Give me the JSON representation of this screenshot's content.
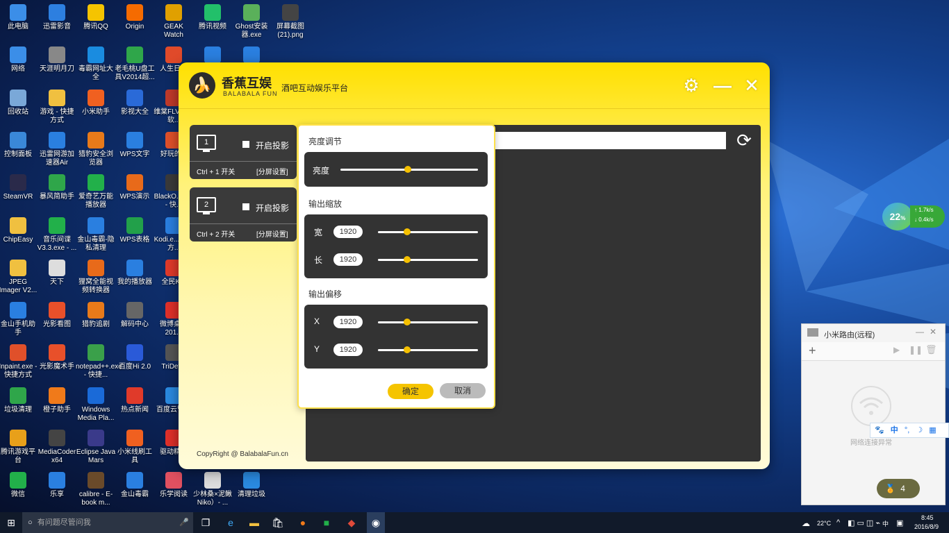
{
  "desktop": {
    "icons": [
      {
        "label": "此电脑",
        "color": "#3b8ee8"
      },
      {
        "label": "迅雷影音",
        "color": "#2d7fe0"
      },
      {
        "label": "腾讯QQ",
        "color": "#f5c400"
      },
      {
        "label": "Origin",
        "color": "#f56b00"
      },
      {
        "label": "GEAK Watch",
        "color": "#e0a000"
      },
      {
        "label": "腾讯视频",
        "color": "#22c06a"
      },
      {
        "label": "Ghost安装器.exe",
        "color": "#5ab05a"
      },
      {
        "label": "屏幕截图(21).png",
        "color": "#444"
      },
      {
        "label": "网络",
        "color": "#3b8ee8"
      },
      {
        "label": "天涯明月刀",
        "color": "#888"
      },
      {
        "label": "毒霸网址大全",
        "color": "#1a8ce0"
      },
      {
        "label": "老毛桃U盘工具V2014超...",
        "color": "#2fa64a"
      },
      {
        "label": "人生日历",
        "color": "#e04a2a"
      },
      {
        "label": "",
        "color": "#2a7fe0"
      },
      {
        "label": "",
        "color": "#2a7fe0"
      },
      {
        "label": "回收站",
        "color": "#7aa8d8"
      },
      {
        "label": "游戏 - 快捷方式",
        "color": "#f0c040"
      },
      {
        "label": "小米助手",
        "color": "#f06020"
      },
      {
        "label": "影视大全",
        "color": "#2a6ad8"
      },
      {
        "label": "维棠FLV下载软...",
        "color": "#c03a2a"
      },
      {
        "label": "控制面板",
        "color": "#3a88d8"
      },
      {
        "label": "迅雷网游加速器Air",
        "color": "#2a7fe0"
      },
      {
        "label": "猎豹安全浏览器",
        "color": "#e87a1a"
      },
      {
        "label": "WPS文字",
        "color": "#2a7fe0"
      },
      {
        "label": "好玩的...",
        "color": "#e0502a"
      },
      {
        "label": "SteamVR",
        "color": "#2a2a4a"
      },
      {
        "label": "暴风简助手",
        "color": "#2fa64a"
      },
      {
        "label": "爱奇艺万能播放器",
        "color": "#22b04a"
      },
      {
        "label": "WPS演示",
        "color": "#e86a1a"
      },
      {
        "label": "BlackO...exe - 快...",
        "color": "#3a3a3a"
      },
      {
        "label": "ChipEasy",
        "color": "#f0c040"
      },
      {
        "label": "音乐间谍V3.3.exe - ...",
        "color": "#22b04a"
      },
      {
        "label": "金山毒霸-隐私清理",
        "color": "#2a7fe0"
      },
      {
        "label": "WPS表格",
        "color": "#22a04a"
      },
      {
        "label": "Kodi.e...快捷方...",
        "color": "#2a7fe0"
      },
      {
        "label": "JPEG Imager V2...",
        "color": "#f0c040"
      },
      {
        "label": "天下",
        "color": "#ddd"
      },
      {
        "label": "狸窝全能视频转换器",
        "color": "#e86a1a"
      },
      {
        "label": "我的播放器",
        "color": "#2a7fe0"
      },
      {
        "label": "全民K...",
        "color": "#e03a2a"
      },
      {
        "label": "金山手机助手",
        "color": "#2a7fe0"
      },
      {
        "label": "光影看图",
        "color": "#e8502a"
      },
      {
        "label": "猎豹追剧",
        "color": "#e87a1a"
      },
      {
        "label": "解码中心",
        "color": "#666"
      },
      {
        "label": "微博桌面201...",
        "color": "#e0302a"
      },
      {
        "label": "Inpaint.exe - 快捷方式",
        "color": "#e0502a"
      },
      {
        "label": "光影魔术手",
        "color": "#e8502a"
      },
      {
        "label": "notepad++.exe - 快捷...",
        "color": "#3aa04a"
      },
      {
        "label": "百度Hi 2.0",
        "color": "#2a5ad8"
      },
      {
        "label": "TriDef...",
        "color": "#555"
      },
      {
        "label": "垃圾清理",
        "color": "#2fa64a"
      },
      {
        "label": "橙子助手",
        "color": "#f07a1a"
      },
      {
        "label": "Windows Media Pla...",
        "color": "#1a6ad8"
      },
      {
        "label": "热点新闻",
        "color": "#e03a2a"
      },
      {
        "label": "百度云管家",
        "color": "#2a8ae0"
      },
      {
        "label": "腾讯游戏平台",
        "color": "#e8a01a"
      },
      {
        "label": "MediaCoder x64",
        "color": "#444"
      },
      {
        "label": "Eclipse Java Mars",
        "color": "#3a3a8a"
      },
      {
        "label": "小米线刷工具",
        "color": "#f06020"
      },
      {
        "label": "驱动精灵",
        "color": "#e0302a"
      },
      {
        "label": "微信",
        "color": "#22b04a"
      },
      {
        "label": "乐享",
        "color": "#2a7fe0"
      },
      {
        "label": "calibre - E-book m...",
        "color": "#6a4a2a"
      },
      {
        "label": "金山毒霸",
        "color": "#2a7fe0"
      },
      {
        "label": "乐学阅读",
        "color": "#e05060"
      },
      {
        "label": "少林桑×泥鳅Niko）- ...",
        "color": "#ddd"
      },
      {
        "label": "清理垃圾",
        "color": "#2a8ae0"
      }
    ]
  },
  "app": {
    "logo_title": "香蕉互娱",
    "logo_sub": "BALABALA FUN",
    "tagline": "酒吧互动娱乐平台",
    "screens": [
      {
        "num": "1",
        "project_label": "开启投影",
        "hotkey": "Ctrl + 1 开关",
        "split": "[分屏设置]"
      },
      {
        "num": "2",
        "project_label": "开启投影",
        "hotkey": "Ctrl + 2 开关",
        "split": "[分屏设置]"
      }
    ],
    "copyright": "CopyRight @ BalabalaFun.cn",
    "settings": {
      "brightness_title": "亮度调节",
      "brightness_label": "亮度",
      "brightness_level": 0.49,
      "scale_title": "输出缩放",
      "width_label": "宽",
      "width_value": "1920",
      "width_level": 0.29,
      "height_label": "长",
      "height_value": "1920",
      "height_level": 0.29,
      "offset_title": "输出偏移",
      "x_label": "X",
      "x_value": "1920",
      "x_level": 0.29,
      "y_label": "Y",
      "y_value": "1920",
      "y_level": 0.29,
      "ok": "确定",
      "cancel": "取消"
    }
  },
  "widgets": {
    "temp_ball": "22",
    "temp_unit": "%",
    "up_speed": "↑ 1.7k/s",
    "down_speed": "↓ 0.4k/s",
    "mi_title": "小米路由(远程)",
    "mi_status": "网络连接异常",
    "ime": "中",
    "badge_count": "4"
  },
  "taskbar": {
    "search_placeholder": "有问题尽管问我",
    "weather": "22°C",
    "ime_lang": "中",
    "time": "8:45",
    "date": "2016/8/9"
  }
}
